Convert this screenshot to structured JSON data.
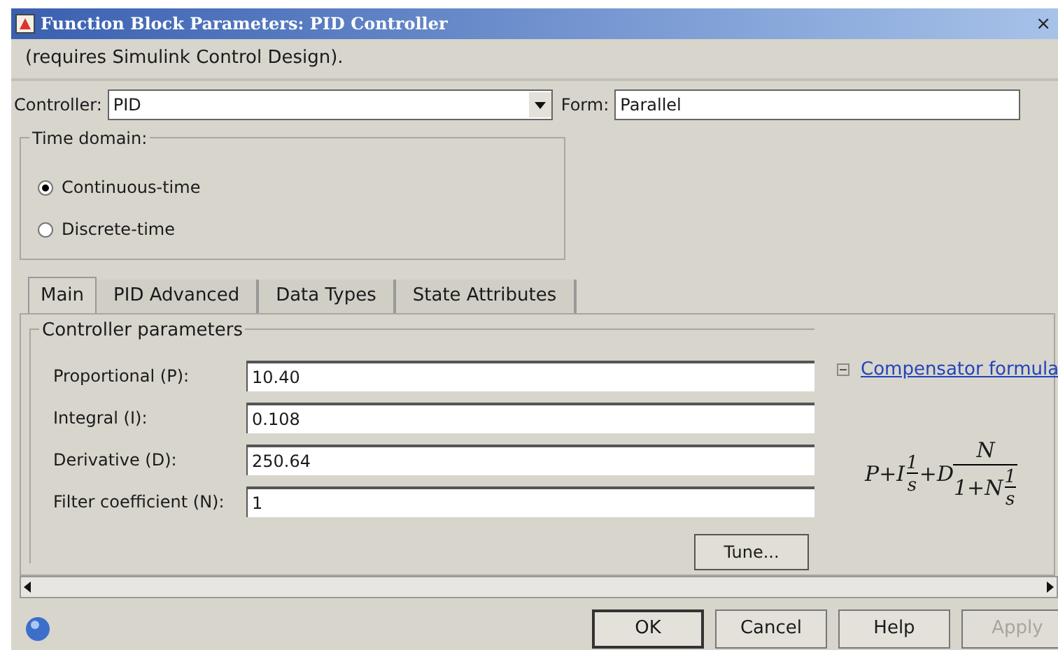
{
  "window": {
    "title": "Function Block Parameters: PID Controller",
    "close": "×"
  },
  "description": "(requires Simulink Control Design).",
  "controller": {
    "label": "Controller:",
    "value": "PID"
  },
  "form": {
    "label": "Form:",
    "value": "Parallel"
  },
  "time_domain": {
    "title": "Time domain:",
    "options": [
      {
        "label": "Continuous-time",
        "selected": true
      },
      {
        "label": "Discrete-time",
        "selected": false
      }
    ]
  },
  "tabs": [
    {
      "label": "Main",
      "selected": true
    },
    {
      "label": "PID Advanced",
      "selected": false
    },
    {
      "label": "Data Types",
      "selected": false
    },
    {
      "label": "State Attributes",
      "selected": false
    }
  ],
  "controller_parameters": {
    "title": "Controller parameters",
    "fields": [
      {
        "label": "Proportional (P):",
        "value": "10.40"
      },
      {
        "label": "Integral (I):",
        "value": "0.108"
      },
      {
        "label": "Derivative (D):",
        "value": "250.64"
      },
      {
        "label": "Filter coefficient (N):",
        "value": "1"
      }
    ]
  },
  "compensator": {
    "expanded": true,
    "link": "Compensator formula",
    "formula": {
      "lead": "P+I",
      "f1_num": "1",
      "f1_den": "s",
      "mid": "+D",
      "f2_num": "N",
      "f2_den": "1+N",
      "f3_num": "1",
      "f3_den": "s"
    }
  },
  "tune_button": "Tune...",
  "buttons": [
    {
      "label": "OK",
      "disabled": false,
      "default": true
    },
    {
      "label": "Cancel",
      "disabled": false,
      "default": false
    },
    {
      "label": "Help",
      "disabled": false,
      "default": false
    },
    {
      "label": "Apply",
      "disabled": true,
      "default": false
    }
  ]
}
